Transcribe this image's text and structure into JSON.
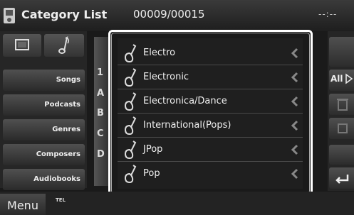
{
  "header": {
    "title": "Category List",
    "counter": "00009/00015",
    "clock": "--:--"
  },
  "left_panel": {
    "categories": [
      "Songs",
      "Podcasts",
      "Genres",
      "Composers",
      "Audiobooks"
    ]
  },
  "alphabet": [
    "1",
    "A",
    "B",
    "C",
    "D"
  ],
  "list": {
    "items": [
      "Electro",
      "Electronic",
      "Electronica/Dance",
      "International(Pops)",
      "JPop",
      "Pop"
    ]
  },
  "right_panel": {
    "all_label": "All"
  },
  "bottom": {
    "menu_label": "Menu",
    "tel_label": "TEL"
  },
  "colors": {
    "background": "#1a1a1a",
    "highlight_frame": "#ffffff",
    "text": "#f0f0f0"
  }
}
